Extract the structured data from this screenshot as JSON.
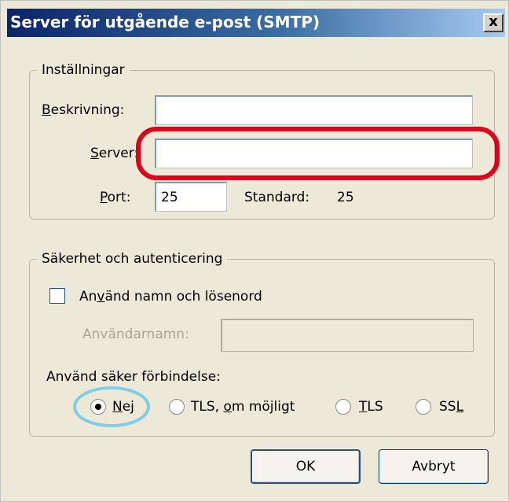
{
  "window": {
    "title": "Server för utgående e-post (SMTP)",
    "close_label": "x"
  },
  "settings": {
    "legend": "Inställningar",
    "description": {
      "label_first": "B",
      "label_rest": "eskrivning:",
      "value": ""
    },
    "server": {
      "label_first": "S",
      "label_rest": "erver:",
      "value": ""
    },
    "port": {
      "label_first": "P",
      "label_rest": "ort:",
      "value": "25"
    },
    "standard": {
      "label": "Standard:",
      "value": "25"
    }
  },
  "security": {
    "legend": "Säkerhet och autenticering",
    "use_credentials": {
      "label_pre": "An",
      "label_ul": "v",
      "label_post": "änd namn och lösenord",
      "checked": false
    },
    "username": {
      "label": "Användarnamn:",
      "value": ""
    },
    "secure_connection_label": "Använd säker förbindelse:",
    "options": [
      {
        "label_pre": "",
        "label_ul": "N",
        "label_post": "ej",
        "selected": true
      },
      {
        "label_pre": "TLS, ",
        "label_ul": "o",
        "label_post": "m möjligt",
        "selected": false
      },
      {
        "label_pre": "",
        "label_ul": "T",
        "label_post": "LS",
        "selected": false
      },
      {
        "label_pre": "SS",
        "label_ul": "L",
        "label_post": "",
        "selected": false
      }
    ]
  },
  "buttons": {
    "ok": "OK",
    "cancel": "Avbryt"
  },
  "colors": {
    "annotation_red": "#e0001a",
    "annotation_blue": "#7fcde8"
  }
}
